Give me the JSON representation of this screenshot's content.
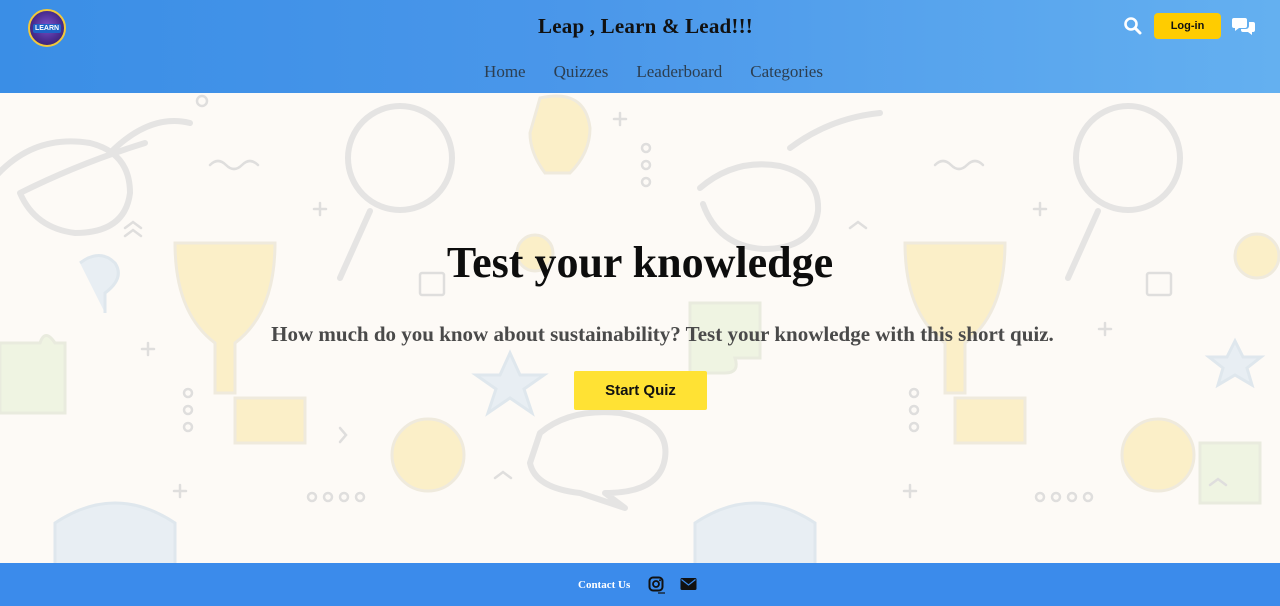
{
  "header": {
    "logo_text": "LEARN",
    "title": "Leap , Learn & Lead!!!",
    "nav": [
      {
        "label": "Home"
      },
      {
        "label": "Quizzes"
      },
      {
        "label": "Leaderboard"
      },
      {
        "label": "Categories"
      }
    ],
    "search_icon": "search-icon",
    "login_label": "Log-in",
    "chat_icon": "chat-bubbles-icon"
  },
  "hero": {
    "title": "Test your knowledge",
    "subtitle": "How much do you know about sustainability? Test your knowledge with this short quiz.",
    "start_label": "Start Quiz"
  },
  "footer": {
    "contact_label": "Contact Us",
    "instagram_icon": "instagram-icon",
    "mail_icon": "mail-icon"
  },
  "colors": {
    "header_blue": "#3a8ee6",
    "footer_blue": "#3b8beb",
    "accent_yellow": "#ffcc00",
    "button_yellow": "#ffe234",
    "background": "#fdfaf6"
  }
}
